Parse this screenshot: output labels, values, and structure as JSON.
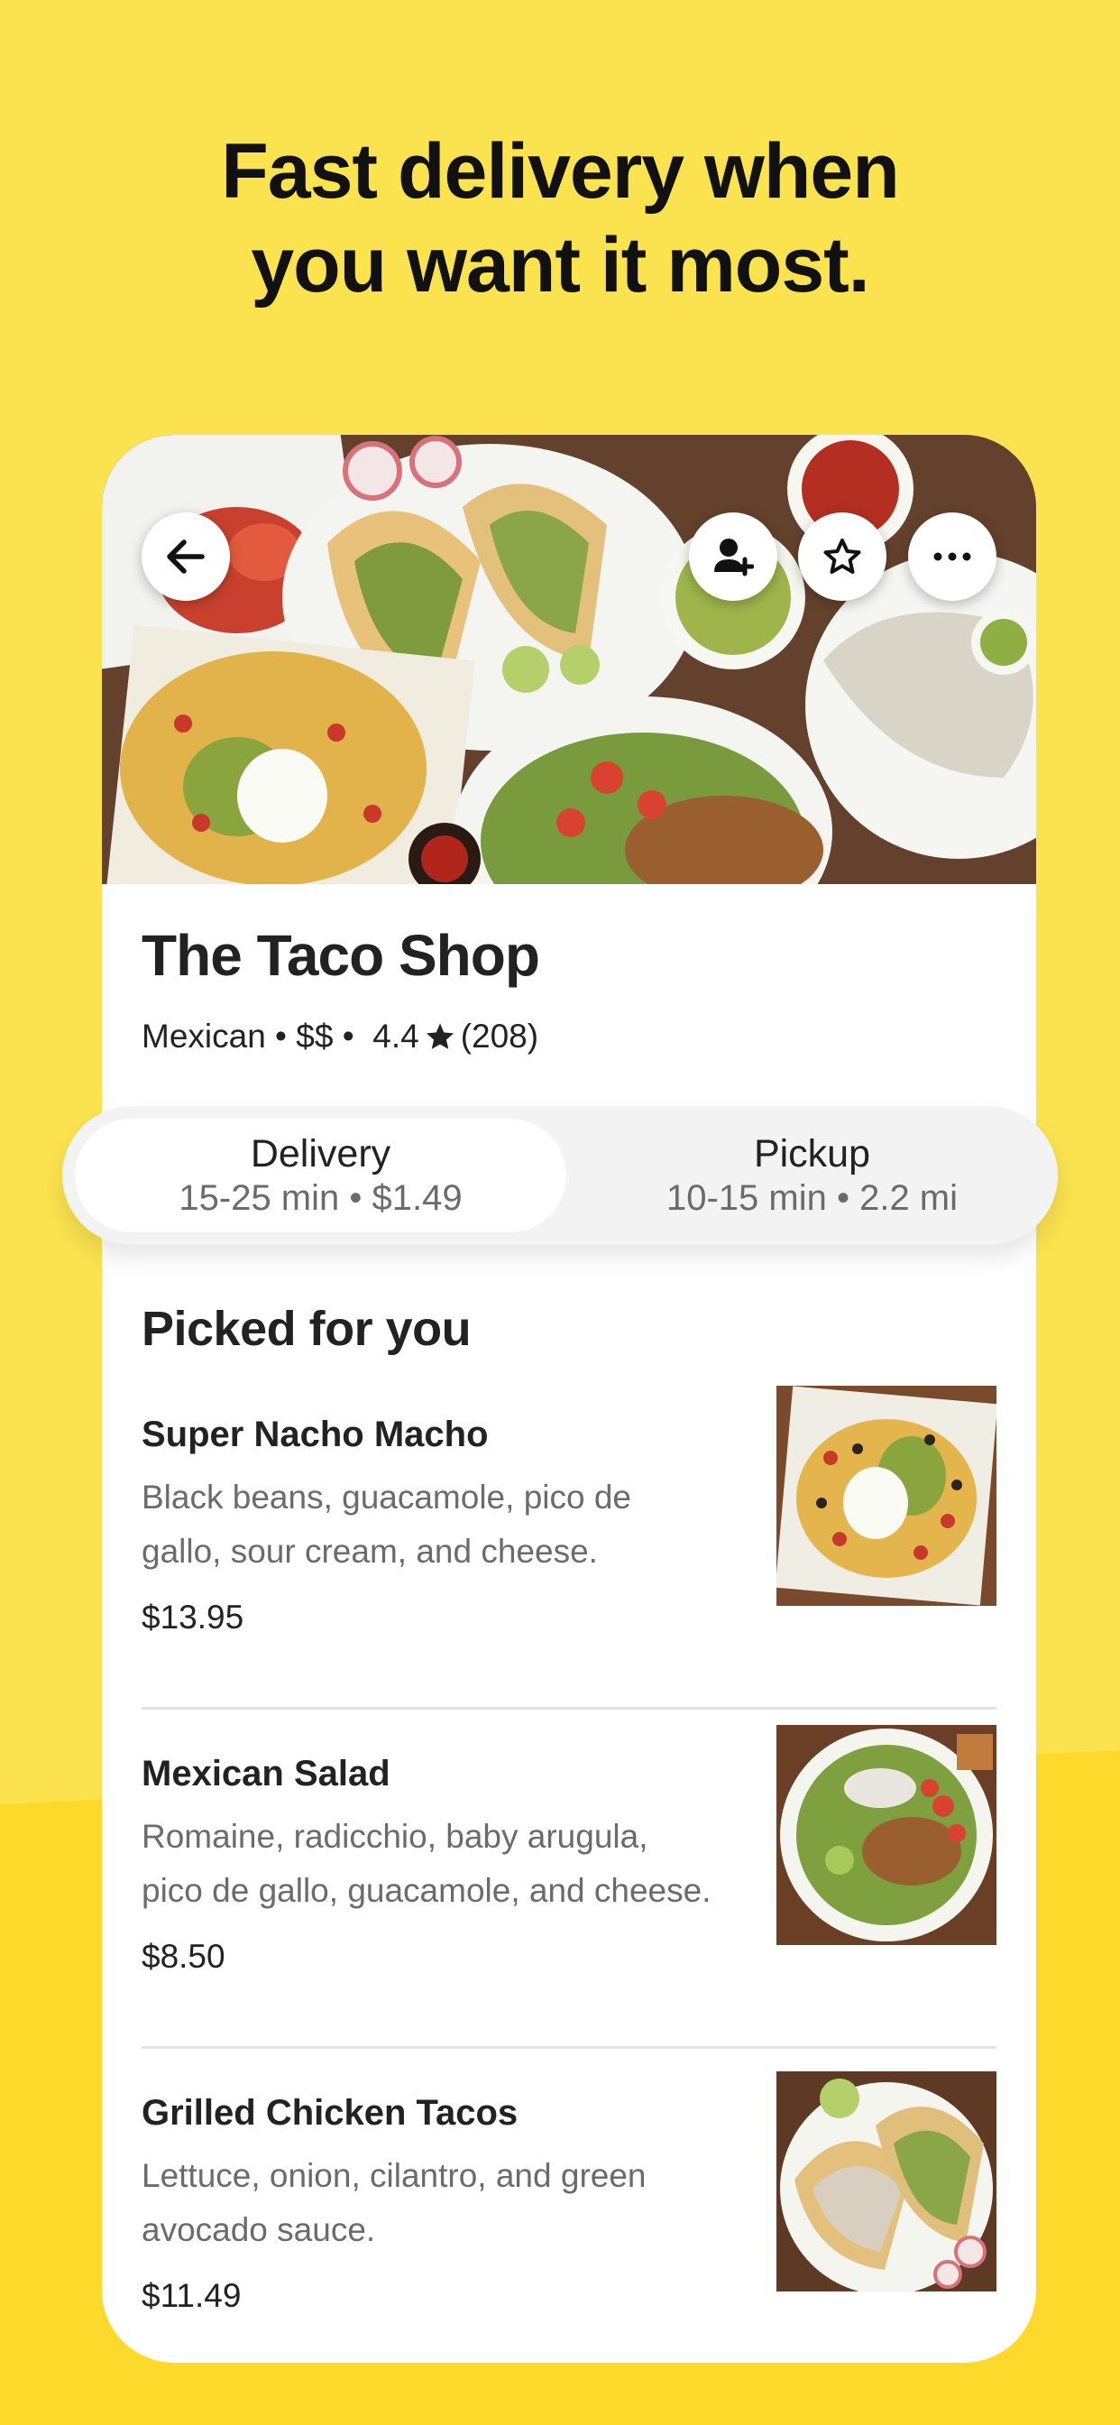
{
  "headline": {
    "line1": "Fast delivery when",
    "line2": "you want it most."
  },
  "store": {
    "name": "The Taco Shop",
    "cuisine": "Mexican",
    "price_level": "$$",
    "rating": "4.4",
    "reviews": "(208)"
  },
  "hero_buttons": {
    "back": "back-arrow-icon",
    "add_person": "add-person-icon",
    "favorite": "star-outline-icon",
    "more": "more-horizontal-icon"
  },
  "toggle": {
    "delivery": {
      "label": "Delivery",
      "detail": "15-25 min • $1.49",
      "selected": true
    },
    "pickup": {
      "label": "Pickup",
      "detail": "10-15 min • 2.2 mi",
      "selected": false
    }
  },
  "section": {
    "title": "Picked for you"
  },
  "items": [
    {
      "name": "Super Nacho Macho",
      "desc1": "Black beans, guacamole, pico de",
      "desc2": "gallo, sour cream, and cheese.",
      "price": "$13.95"
    },
    {
      "name": "Mexican Salad",
      "desc1": "Romaine, radicchio, baby arugula,",
      "desc2": "pico de gallo, guacamole, and cheese.",
      "price": "$8.50"
    },
    {
      "name": "Grilled Chicken Tacos",
      "desc1": "Lettuce, onion, cilantro, and green",
      "desc2": "avocado sauce.",
      "price": "$11.49"
    }
  ],
  "colors": {
    "background_yellow": "#fbe24f",
    "background_yellow_dark": "#fcd92a",
    "text_primary": "#222222",
    "text_secondary": "#6b6b6b"
  }
}
